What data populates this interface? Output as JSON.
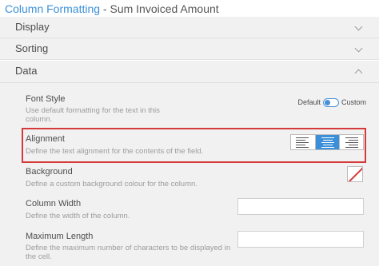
{
  "title": {
    "accent": "Column Formatting",
    "rest": " - Sum Invoiced Amount"
  },
  "sections": {
    "display": "Display",
    "sorting": "Sorting",
    "data": "Data"
  },
  "font_style": {
    "label": "Font Style",
    "description": "Use default formatting for the text in this column.",
    "toggle_left": "Default",
    "toggle_right": "Custom",
    "selected": "Default"
  },
  "alignment": {
    "label": "Alignment",
    "description": "Define the text alignment for the contents of the field.",
    "options": [
      "left-align-icon",
      "center-align-icon",
      "right-align-icon"
    ],
    "selected": "center"
  },
  "background": {
    "label": "Background",
    "description": "Define a custom background colour for the column."
  },
  "column_width": {
    "label": "Column Width",
    "description": "Define the width of the column.",
    "value": ""
  },
  "maximum_length": {
    "label": "Maximum Length",
    "description": "Define the maximum number of characters to be displayed in the cell.",
    "value": ""
  },
  "colors": {
    "accent": "#3b8fd8",
    "highlight": "#d53a3a",
    "panel": "#f1f1f1"
  }
}
